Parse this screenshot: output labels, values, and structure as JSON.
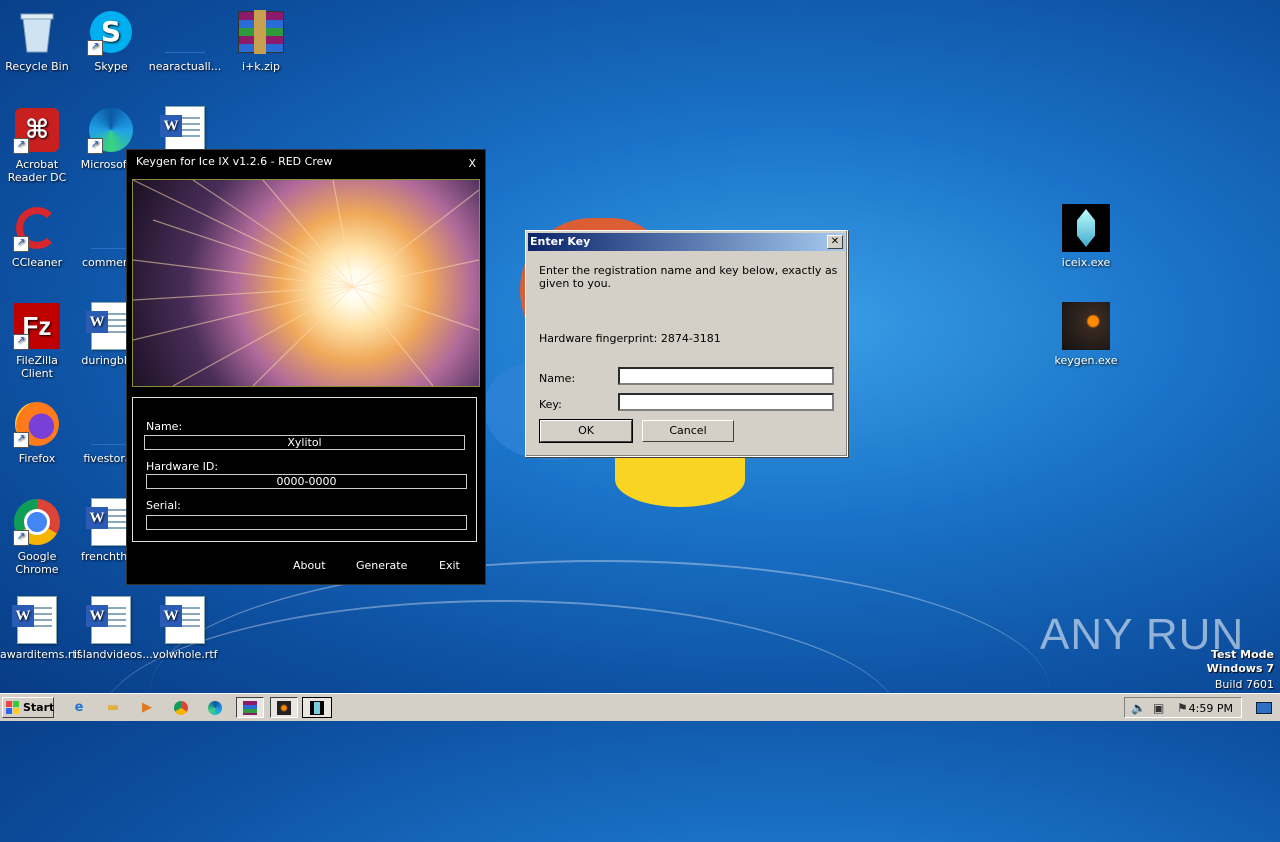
{
  "desktop": {
    "icons": [
      {
        "label": "Recycle Bin",
        "icon": "recycle-bin-icon"
      },
      {
        "label": "Skype",
        "icon": "skype-icon"
      },
      {
        "label": "nearactuall...",
        "icon": "blank-file-icon"
      },
      {
        "label": "i+k.zip",
        "icon": "winrar-archive-icon"
      },
      {
        "label": "Acrobat Reader DC",
        "icon": "acrobat-icon"
      },
      {
        "label": "Microsoft E",
        "icon": "edge-icon"
      },
      {
        "label": "",
        "icon": "word-document-icon"
      },
      {
        "label": "CCleaner",
        "icon": "ccleaner-icon"
      },
      {
        "label": "commerce",
        "icon": "blank-file-icon"
      },
      {
        "label": "FileZilla Client",
        "icon": "filezilla-icon"
      },
      {
        "label": "duringblue",
        "icon": "word-document-icon"
      },
      {
        "label": "Firefox",
        "icon": "firefox-icon"
      },
      {
        "label": "fivestorag",
        "icon": "blank-file-icon"
      },
      {
        "label": "Google Chrome",
        "icon": "chrome-icon"
      },
      {
        "label": "frenchthan",
        "icon": "word-document-icon"
      },
      {
        "label": "awarditems.rtf",
        "icon": "word-document-icon"
      },
      {
        "label": "islandvideos....",
        "icon": "word-document-icon"
      },
      {
        "label": "volwhole.rtf",
        "icon": "word-document-icon"
      },
      {
        "label": "iceix.exe",
        "icon": "crystal-icon"
      },
      {
        "label": "keygen.exe",
        "icon": "skull-icon"
      }
    ]
  },
  "keygen": {
    "title": "Keygen for Ice IX v1.2.6 - RED Crew",
    "close": "X",
    "name_label": "Name:",
    "name_value": "Xylitol",
    "hwid_label": "Hardware ID:",
    "hwid_value": "0000-0000",
    "serial_label": "Serial:",
    "serial_value": "",
    "about": "About",
    "generate": "Generate",
    "exit": "Exit"
  },
  "dialog": {
    "title": "Enter Key",
    "message": "Enter the registration name and key below, exactly as given to you.",
    "fingerprint": "Hardware fingerprint: 2874-3181",
    "name_label": "Name:",
    "key_label": "Key:",
    "name_value": "",
    "key_value": "",
    "ok": "OK",
    "cancel": "Cancel"
  },
  "taskbar": {
    "start": "Start",
    "clock": "4:59 PM"
  },
  "watermark": {
    "line1": "Test Mode",
    "line2": "Windows 7",
    "line3": "Build 7601",
    "brand": "ANY RUN"
  }
}
